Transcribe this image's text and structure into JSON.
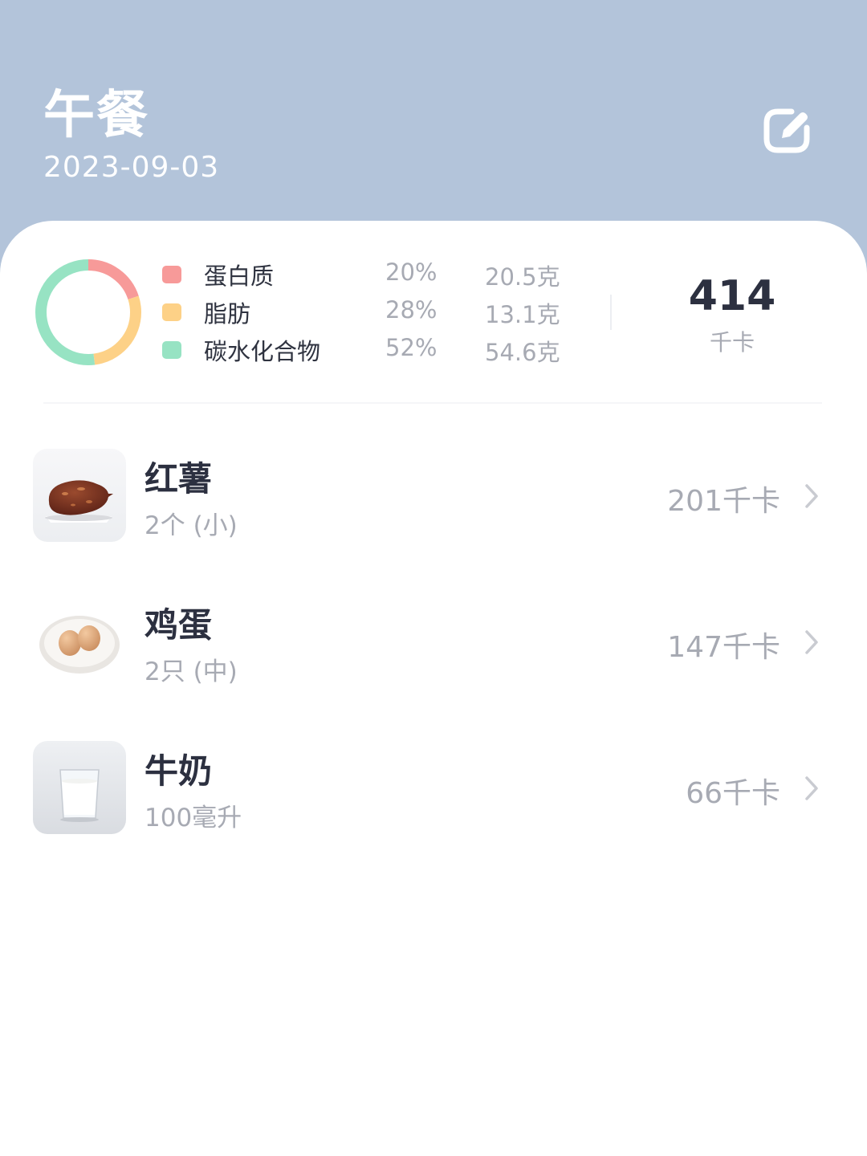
{
  "header": {
    "title": "午餐",
    "date": "2023-09-03",
    "edit_icon": "edit-icon"
  },
  "summary": {
    "macros": [
      {
        "name": "蛋白质",
        "percent": "20%",
        "grams": "20.5克",
        "color": "#f79a99",
        "share": 20
      },
      {
        "name": "脂肪",
        "percent": "28%",
        "grams": "13.1克",
        "color": "#fdd187",
        "share": 28
      },
      {
        "name": "碳水化合物",
        "percent": "52%",
        "grams": "54.6克",
        "color": "#97e3c3",
        "share": 52
      }
    ],
    "total_kcal": "414",
    "total_unit": "千卡"
  },
  "foods": [
    {
      "name": "红薯",
      "quantity": "2个 (小)",
      "kcal": "201千卡",
      "thumb": "sweet-potato-image"
    },
    {
      "name": "鸡蛋",
      "quantity": "2只 (中)",
      "kcal": "147千卡",
      "thumb": "eggs-image"
    },
    {
      "name": "牛奶",
      "quantity": "100毫升",
      "kcal": "66千卡",
      "thumb": "milk-image"
    }
  ]
}
